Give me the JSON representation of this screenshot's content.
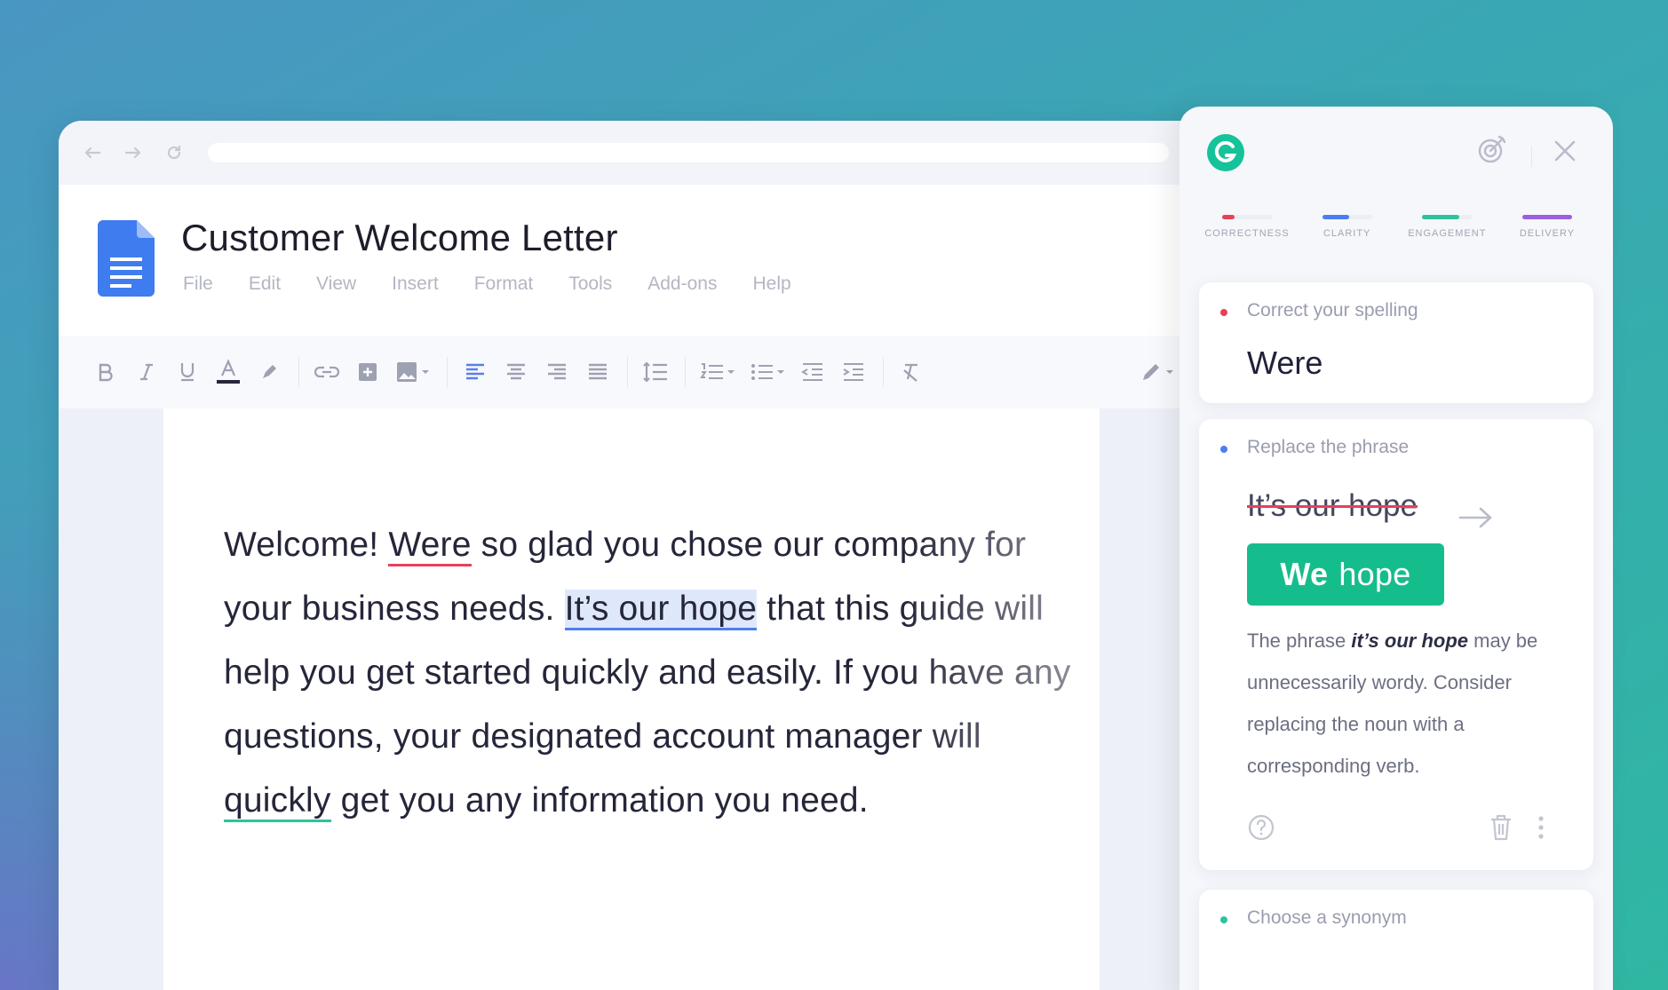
{
  "browser": {
    "icons": [
      "back-arrow-icon",
      "forward-arrow-icon",
      "reload-icon"
    ]
  },
  "document": {
    "title": "Customer Welcome Letter",
    "menu": [
      "File",
      "Edit",
      "View",
      "Insert",
      "Format",
      "Tools",
      "Add-ons",
      "Help"
    ],
    "text": {
      "seg1": "Welcome! ",
      "err1": "Were",
      "seg2": " so glad you chose our company for your business needs. ",
      "highlight": "It’s our hope",
      "seg3": " that this guide will help you get started quickly and easily. If you have any questions, your designated account manager will ",
      "err2": "quickly",
      "seg4": " get you any information you need."
    }
  },
  "grammarly": {
    "categories": [
      {
        "label": "CORRECTNESS",
        "color": "#e8405a",
        "level": 0.25
      },
      {
        "label": "CLARITY",
        "color": "#4d7ef0",
        "level": 0.55
      },
      {
        "label": "ENGAGEMENT",
        "color": "#2fc29d",
        "level": 0.75
      },
      {
        "label": "DELIVERY",
        "color": "#9b5fe0",
        "level": 1.0
      }
    ],
    "card1": {
      "title": "Correct your spelling",
      "word": "Were",
      "dot_color": "#e8405a"
    },
    "card2": {
      "title": "Replace the phrase",
      "original": "It’s our hope",
      "suggest_bold": "We",
      "suggest_rest": "hope",
      "dot_color": "#4d7ef0",
      "expl_pre": "The phrase ",
      "expl_em": "it’s our hope",
      "expl_post": " may be unnecessarily wordy. Consider replacing the noun with a corresponding verb."
    },
    "card3": {
      "title": "Choose a synonym",
      "dot_color": "#2fc29d"
    }
  }
}
